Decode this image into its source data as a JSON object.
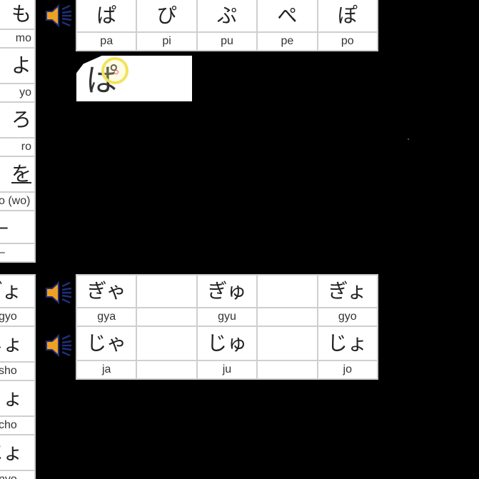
{
  "left_top_table": {
    "rows": [
      {
        "kana": "も",
        "romaji": "mo"
      },
      {
        "kana": "よ",
        "romaji": "yo"
      },
      {
        "kana": "ろ",
        "romaji": "ro"
      },
      {
        "kana": "を",
        "romaji": "o (wo)"
      },
      {
        "kana": "–",
        "romaji": "–"
      }
    ]
  },
  "left_bottom_table": {
    "rows": [
      {
        "kana": "ぎょ",
        "romaji": "gyo"
      },
      {
        "kana": "しょ",
        "romaji": "sho"
      },
      {
        "kana": "ちょ",
        "romaji": "cho"
      },
      {
        "kana": "にょ",
        "romaji": "nyo"
      }
    ]
  },
  "p_row": {
    "cells": [
      {
        "kana": "ぱ",
        "romaji": "pa"
      },
      {
        "kana": "ぴ",
        "romaji": "pi"
      },
      {
        "kana": "ぷ",
        "romaji": "pu"
      },
      {
        "kana": "ぺ",
        "romaji": "pe"
      },
      {
        "kana": "ぽ",
        "romaji": "po"
      }
    ]
  },
  "stroke_preview": {
    "kana": "ぱ"
  },
  "gy_row": {
    "cells": [
      {
        "kana": "ぎゃ",
        "romaji": "gya"
      },
      {
        "kana": "",
        "romaji": ""
      },
      {
        "kana": "ぎゅ",
        "romaji": "gyu"
      },
      {
        "kana": "",
        "romaji": ""
      },
      {
        "kana": "ぎょ",
        "romaji": "gyo"
      }
    ]
  },
  "j_row": {
    "cells": [
      {
        "kana": "じゃ",
        "romaji": "ja"
      },
      {
        "kana": "",
        "romaji": ""
      },
      {
        "kana": "じゅ",
        "romaji": "ju"
      },
      {
        "kana": "",
        "romaji": ""
      },
      {
        "kana": "じょ",
        "romaji": "jo"
      }
    ]
  },
  "colors": {
    "speaker_body": "#f0a020",
    "speaker_outline": "#1f2f7a",
    "cell_border": "#cfcfcf",
    "cursor_ring": "#f2e35a"
  },
  "icons": {
    "speaker": "speaker-icon"
  }
}
